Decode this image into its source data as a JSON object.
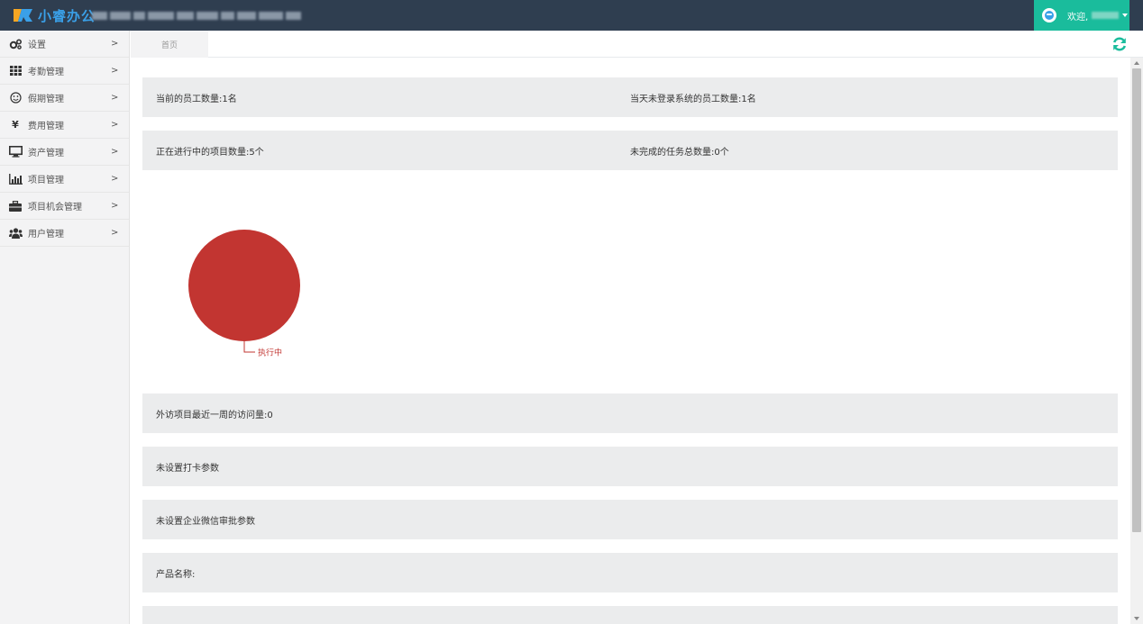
{
  "header": {
    "app_name": "小睿办公",
    "company_blurred": true,
    "welcome": "欢迎,",
    "accent_color": "#1abc9c",
    "bar_color": "#2f3e50"
  },
  "sidebar": {
    "items": [
      {
        "label": "设置",
        "icon": "gear-icon"
      },
      {
        "label": "考勤管理",
        "icon": "grid-icon"
      },
      {
        "label": "假期管理",
        "icon": "smile-icon"
      },
      {
        "label": "费用管理",
        "icon": "yen-icon"
      },
      {
        "label": "资产管理",
        "icon": "monitor-icon"
      },
      {
        "label": "项目管理",
        "icon": "bar-chart-icon"
      },
      {
        "label": "项目机会管理",
        "icon": "briefcase-icon"
      },
      {
        "label": "用户管理",
        "icon": "users-icon"
      }
    ],
    "arrow": ">"
  },
  "tabs": {
    "home": "首页"
  },
  "stats": {
    "employee_count": "当前的员工数量:1名",
    "not_logged_in": "当天未登录系统的员工数量:1名",
    "projects_in_progress": "正在进行中的项目数量:5个",
    "unfinished_tasks": "未完成的任务总数量:0个",
    "visit_count": "外访项目最近一周的访问量:0",
    "checkin_params": "未设置打卡参数",
    "wechat_params": "未设置企业微信审批参数",
    "product_name": "产品名称:"
  },
  "chart_data": {
    "type": "pie",
    "categories": [
      "执行中"
    ],
    "values": [
      1
    ],
    "colors": [
      "#c23531"
    ]
  }
}
